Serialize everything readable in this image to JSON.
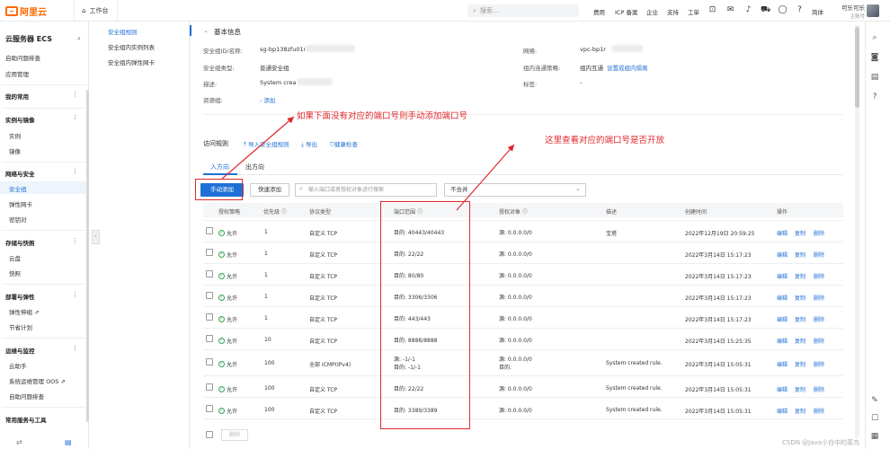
{
  "top": {
    "logo": "阿里云",
    "workspace": "工作台",
    "search_placeholder": "搜索...",
    "nav": [
      "费用",
      "ICP 备案",
      "企业",
      "支持",
      "工单"
    ],
    "lang": "简体",
    "user_name": "可乐可乐",
    "user_role": "主账号"
  },
  "sidebar": {
    "title": "云服务器 ECS",
    "items": {
      "auto_check": "自助问题排查",
      "app_manage": "应用管理",
      "common": "我的常用",
      "instance_img": "实例与镜像",
      "instance": "实例",
      "image": "镜像",
      "net_sec": "网络与安全",
      "sec_group": "安全组",
      "eni": "弹性网卡",
      "keypair": "密钥对",
      "storage": "存储与快照",
      "disk": "云盘",
      "snapshot": "快照",
      "deploy": "部署与弹性",
      "autoscale": "弹性伸缩",
      "saving": "节省计划",
      "ops": "运维与监控",
      "assistant": "云助手",
      "oos": "系统运维管理 OOS",
      "auto_check2": "自助问题排查",
      "common_tools": "常用服务与工具"
    }
  },
  "subnav": [
    "安全组规则",
    "安全组内实例列表",
    "安全组内弹性网卡"
  ],
  "basic": {
    "section": "基本信息",
    "id_label": "安全组ID/名称:",
    "id_value": "sg-bp138zfu01r",
    "type_label": "安全组类型:",
    "type_value": "普通安全组",
    "desc_label": "描述:",
    "desc_value": "System crea",
    "rg_label": "资源组:",
    "rg_value": "- 添加",
    "vpc_label": "网络:",
    "vpc_value": "vpc-bp1r",
    "policy_label": "组内连通策略:",
    "policy_value": "组内互通",
    "policy_link": "设置成组内隔离",
    "tag_label": "标签:",
    "tag_value": "-"
  },
  "rules": {
    "title": "访问规则",
    "import": "导入安全组规则",
    "export": "导出",
    "health": "健康检查",
    "tab_in": "入方向",
    "tab_out": "出方向",
    "btn_manual": "手动添加",
    "btn_quick": "快速添加",
    "search_placeholder": "输入端口或者授权对象进行搜索",
    "select_all": "不合并",
    "headers": [
      "授权策略",
      "优先级",
      "协议类型",
      "端口范围",
      "授权对象",
      "描述",
      "创建时间",
      "操作"
    ],
    "rows": [
      {
        "policy": "允许",
        "priority": "1",
        "proto": "自定义 TCP",
        "port": "目的: 40443/40443",
        "obj": "源: 0.0.0.0/0",
        "desc": "宝塔",
        "time": "2022年12月19日 20:59:25"
      },
      {
        "policy": "允许",
        "priority": "1",
        "proto": "自定义 TCP",
        "port": "目的: 22/22",
        "obj": "源: 0.0.0.0/0",
        "desc": "",
        "time": "2022年3月14日 15:17:23"
      },
      {
        "policy": "允许",
        "priority": "1",
        "proto": "自定义 TCP",
        "port": "目的: 80/80",
        "obj": "源: 0.0.0.0/0",
        "desc": "",
        "time": "2022年3月14日 15:17:23"
      },
      {
        "policy": "允许",
        "priority": "1",
        "proto": "自定义 TCP",
        "port": "目的: 3306/3306",
        "obj": "源: 0.0.0.0/0",
        "desc": "",
        "time": "2022年3月14日 15:17:23"
      },
      {
        "policy": "允许",
        "priority": "1",
        "proto": "自定义 TCP",
        "port": "目的: 443/443",
        "obj": "源: 0.0.0.0/0",
        "desc": "",
        "time": "2022年3月14日 15:17:23"
      },
      {
        "policy": "允许",
        "priority": "10",
        "proto": "自定义 TCP",
        "port": "目的: 8888/8888",
        "obj": "源: 0.0.0.0/0",
        "desc": "",
        "time": "2022年3月14日 15:25:35"
      },
      {
        "policy": "允许",
        "priority": "100",
        "proto": "全部 ICMP(IPv4)",
        "port": "源: -1/-1\n目的: -1/-1",
        "obj": "源: 0.0.0.0/0\n目的:",
        "desc": "System created rule.",
        "time": "2022年3月14日 15:05:31"
      },
      {
        "policy": "允许",
        "priority": "100",
        "proto": "自定义 TCP",
        "port": "目的: 22/22",
        "obj": "源: 0.0.0.0/0",
        "desc": "System created rule.",
        "time": "2022年3月14日 15:05:31"
      },
      {
        "policy": "允许",
        "priority": "100",
        "proto": "自定义 TCP",
        "port": "目的: 3389/3389",
        "obj": "源: 0.0.0.0/0",
        "desc": "System created rule.",
        "time": "2022年3月14日 15:05:31"
      }
    ],
    "actions": [
      "编辑",
      "复制",
      "删除"
    ],
    "btn_delete": "删除"
  },
  "annotations": {
    "a1": "如果下面没有对应的端口号则手动添加端口号",
    "a2": "这里查看对应的端口号是否开放",
    "color": "#e0282b"
  },
  "watermark": "CSDN @Java小白中的菜鸟"
}
